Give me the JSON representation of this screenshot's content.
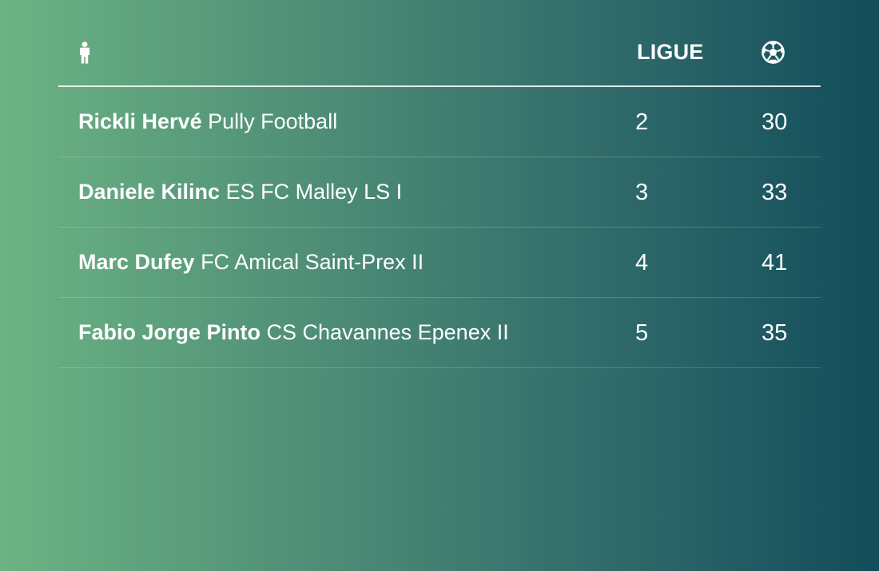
{
  "header": {
    "player_icon": "person-icon",
    "league_label": "LIGUE",
    "goals_icon": "soccer-ball-icon"
  },
  "rows": [
    {
      "name": "Rickli Hervé",
      "club": "Pully Football",
      "league": "2",
      "goals": "30"
    },
    {
      "name": "Daniele Kilinc",
      "club": "ES FC Malley LS I",
      "league": "3",
      "goals": "33"
    },
    {
      "name": "Marc Dufey",
      "club": "FC Amical Saint-Prex II",
      "league": "4",
      "goals": "41"
    },
    {
      "name": "Fabio Jorge Pinto",
      "club": "CS Chavannes Epenex II",
      "league": "5",
      "goals": "35"
    }
  ]
}
